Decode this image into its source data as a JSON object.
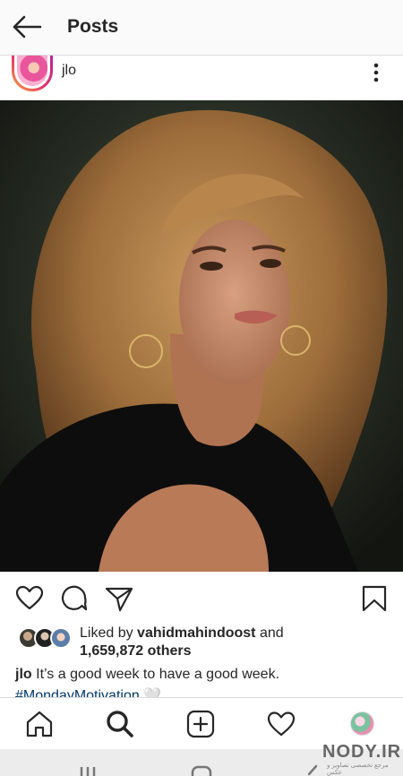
{
  "header": {
    "title": "Posts",
    "back_icon": "arrow-left-icon"
  },
  "post": {
    "username": "jlo",
    "more_icon": "more-vertical-icon",
    "actions": [
      "heart-icon",
      "comment-icon",
      "share-icon",
      "bookmark-icon"
    ],
    "likes": {
      "prefix": "Liked by ",
      "user": "vahidmahindoost",
      "suffix": " and",
      "others": "1,659,872 others"
    },
    "caption": {
      "user": "jlo",
      "text": " It’s a good week to have a good week."
    },
    "hashtag": "#MondayMotivation 🤍"
  },
  "tabbar": [
    "home-icon",
    "search-icon",
    "new-post-icon",
    "activity-heart-icon",
    "profile-avatar"
  ],
  "watermark": {
    "text": "NODY.IR",
    "sub": "مرجع تخصصی تصاویر و عکس"
  },
  "colors": {
    "text": "#262626",
    "link": "#00376b",
    "divider": "#dbdbdb"
  }
}
